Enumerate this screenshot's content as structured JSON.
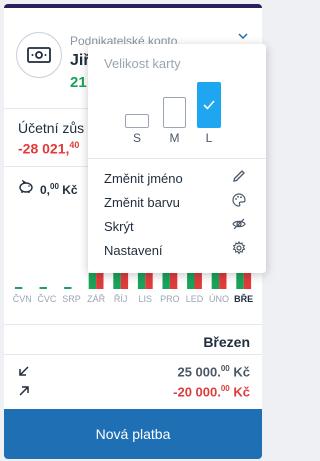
{
  "account": {
    "type": "Podnikatelské konto",
    "name": "Jiř",
    "balance": "21"
  },
  "ledger": {
    "label": "Účetní zůs",
    "value": "-28 021,",
    "value_dec": "40"
  },
  "savings": {
    "amount": "0,",
    "amount_dec": "00",
    "currency": "Kč"
  },
  "months": [
    "ČVN",
    "ČVC",
    "SRP",
    "ZÁŘ",
    "ŘÍJ",
    "LIS",
    "PRO",
    "LED",
    "ÚNO",
    "BŘE"
  ],
  "active_month_index": 9,
  "chart_data": {
    "type": "bar",
    "categories": [
      "ČVN",
      "ČVC",
      "SRP",
      "ZÁŘ",
      "ŘÍJ",
      "LIS",
      "PRO",
      "LED",
      "ÚNO",
      "BŘE"
    ],
    "series": [
      {
        "values": [
          0.1,
          0.1,
          0.1,
          1,
          1,
          1,
          1,
          1,
          1,
          1
        ],
        "color": "#1aa35a"
      },
      {
        "values": [
          0,
          0,
          0,
          1,
          1,
          1,
          1,
          1,
          1,
          1
        ],
        "color": "#e03c3c"
      }
    ]
  },
  "summary": {
    "month": "Březen",
    "income": "25 000.",
    "income_dec": "00",
    "income_cur": " Kč",
    "expense": "-20 000.",
    "expense_dec": "00",
    "expense_cur": " Kč"
  },
  "pay_button": "Nová platba",
  "popup": {
    "title": "Velikost karty",
    "sizes": [
      "S",
      "M",
      "L"
    ],
    "selected_size": "L",
    "items": [
      {
        "label": "Změnit jméno",
        "icon": "pencil-icon"
      },
      {
        "label": "Změnit barvu",
        "icon": "palette-icon"
      },
      {
        "label": "Skrýt",
        "icon": "eye-off-icon"
      },
      {
        "label": "Nastavení",
        "icon": "gear-icon"
      }
    ]
  },
  "colors": {
    "accent": "#1f6fb5",
    "selected": "#1ea7f0",
    "positive": "#1aa35a",
    "negative": "#e03c3c",
    "top_bar": "#2a1f5e"
  }
}
